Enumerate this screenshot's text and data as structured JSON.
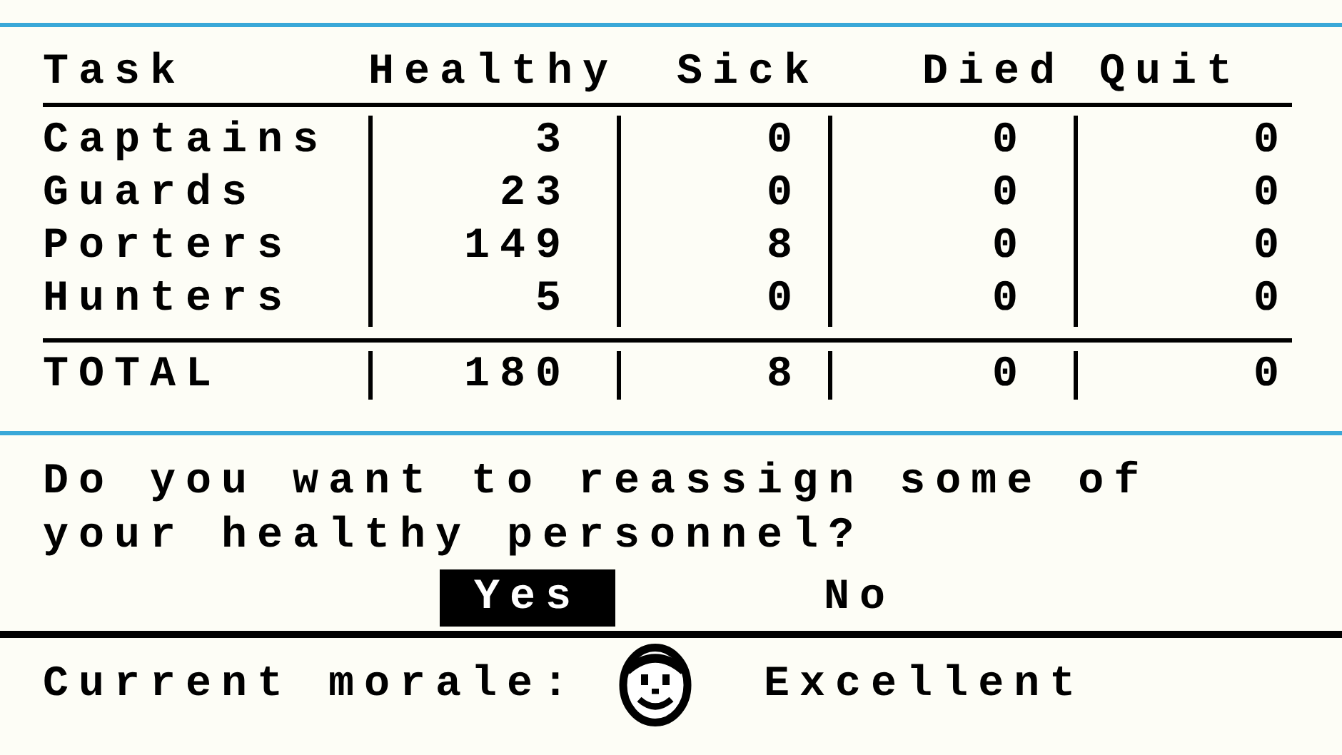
{
  "table": {
    "columns": [
      "Task",
      "Healthy",
      "Sick",
      "Died",
      "Quit"
    ],
    "rows": [
      [
        "Captains",
        "3",
        "0",
        "0",
        "0"
      ],
      [
        "Guards",
        "23",
        "0",
        "0",
        "0"
      ],
      [
        "Porters",
        "149",
        "8",
        "0",
        "0"
      ],
      [
        "Hunters",
        "5",
        "0",
        "0",
        "0"
      ]
    ],
    "total": [
      "TOTAL",
      "180",
      "8",
      "0",
      "0"
    ]
  },
  "question": {
    "text": "Do you want to reassign some of your healthy personnel?",
    "buttons": [
      {
        "label": "Yes",
        "selected": true
      },
      {
        "label": "No",
        "selected": false
      }
    ]
  },
  "status": {
    "label": "Current morale:",
    "value": "Excellent"
  }
}
